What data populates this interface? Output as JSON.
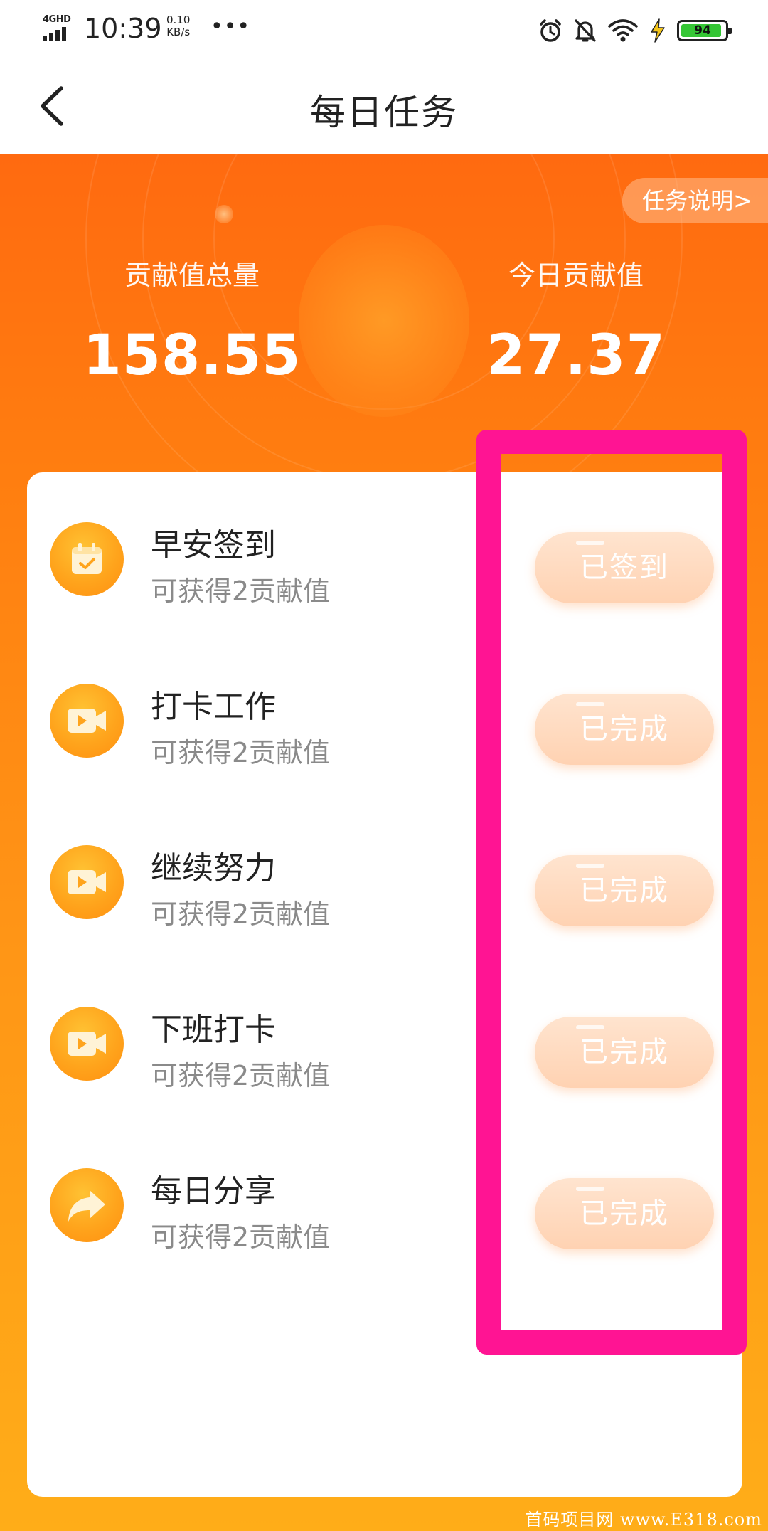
{
  "status_bar": {
    "network": "4GHD",
    "time": "10:39",
    "speed_value": "0.10",
    "speed_unit": "KB/s",
    "more": "•••",
    "battery": "94",
    "battery_level": 0.94,
    "icons": [
      "alarm-icon",
      "mute-icon",
      "wifi-icon",
      "charging-icon",
      "battery-icon"
    ]
  },
  "header": {
    "title": "每日任务"
  },
  "summary": {
    "task_desc_link": "任务说明>",
    "total_label": "贡献值总量",
    "total_value": "158.55",
    "today_label": "今日贡献值",
    "today_value": "27.37"
  },
  "tasks": [
    {
      "title": "早安签到",
      "subtitle": "可获得2贡献值",
      "status": "已签到",
      "icon": "calendar-check-icon"
    },
    {
      "title": "打卡工作",
      "subtitle": "可获得2贡献值",
      "status": "已完成",
      "icon": "video-icon"
    },
    {
      "title": "继续努力",
      "subtitle": "可获得2贡献值",
      "status": "已完成",
      "icon": "video-icon"
    },
    {
      "title": "下班打卡",
      "subtitle": "可获得2贡献值",
      "status": "已完成",
      "icon": "video-icon"
    },
    {
      "title": "每日分享",
      "subtitle": "可获得2贡献值",
      "status": "已完成",
      "icon": "share-arrow-icon"
    }
  ],
  "colors": {
    "accent": "#ff7d10",
    "highlight": "#ff1493",
    "button_done": "#ffd2b2"
  },
  "watermark": "首码项目网 www.E318.com"
}
